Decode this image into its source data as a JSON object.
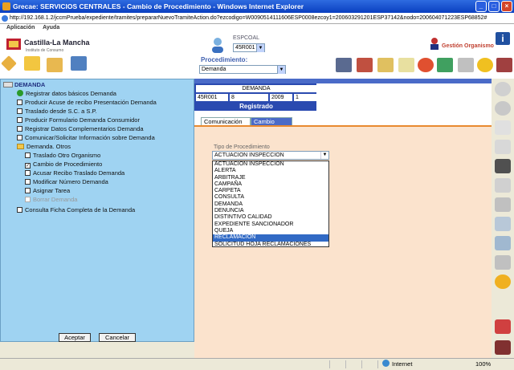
{
  "window": {
    "title": "Grecae: SERVICIOS CENTRALES - Cambio de Procedimiento - Windows Internet Explorer"
  },
  "address": {
    "url": "http://192.168.1.2/jccmPrueba/expediente/tramites/prepararNuevoTramiteAction.do?ezcodigo=W0090514111606ESP0008ezcoy1=200603291201ESP37142&nodo=200604071223ESP68852#"
  },
  "menubar": {
    "items": [
      "Aplicación",
      "Ayuda"
    ]
  },
  "header": {
    "logo_title": "Castilla-La Mancha",
    "logo_subtitle": "Instituto de Consumo",
    "user_label": "ESPCOAL",
    "user_select": "45R001",
    "gestion_label": "Gestión Organismo",
    "info_label": "i",
    "procedimiento_label": "Procedimiento:",
    "procedimiento_select": "Demanda"
  },
  "tree": {
    "root": "DEMANDA",
    "items": [
      {
        "label": "Registrar datos básicos Demanda"
      },
      {
        "label": "Producir Acuse de recibo Presentación Demanda"
      },
      {
        "label": "Traslado desde S.C. a S.P."
      },
      {
        "label": "Producir Formulario Demanda Consumidor"
      },
      {
        "label": "Registrar Datos Complementarios Demanda"
      },
      {
        "label": "Comunicar/Solicitar Información sobre Demanda"
      }
    ],
    "group": "Demanda. Otros",
    "sub_items": [
      {
        "label": "Traslado Otro Organismo"
      },
      {
        "label": "Cambio de Procedimiento",
        "check": "✓"
      },
      {
        "label": "Acusar Recibo Traslado Demanda"
      },
      {
        "label": "Modificar Número Demanda"
      },
      {
        "label": "Asignar Tarea"
      },
      {
        "label": "Borrar Demanda"
      }
    ],
    "last_item": "Consulta Ficha Completa de la Demanda",
    "accept_label": "Aceptar",
    "cancel_label": "Cancelar"
  },
  "demanda_table": {
    "header": "DEMANDA",
    "cells": [
      "45R001",
      "8",
      "2009",
      "1"
    ],
    "status": "Registrado"
  },
  "tabs": [
    {
      "label": "Comunicación"
    },
    {
      "label": "Cambio Proc."
    }
  ],
  "form": {
    "tipo_label": "Tipo de Procedimiento",
    "tipo_value": "ACTUACION INSPECCION",
    "options": [
      "ACTUACION INSPECCION",
      "ALERTA",
      "ARBITRAJE",
      "CAMPAÑA",
      "CARPETA",
      "CONSULTA",
      "DEMANDA",
      "DENUNCIA",
      "DISTINTIVO CALIDAD",
      "EXPEDIENTE SANCIONADOR",
      "QUEJA",
      "RECLAMACION",
      "SOLICITUD HOJA RECLAMACIONES"
    ],
    "highlighted_option": "RECLAMACION"
  },
  "status": {
    "zone": "Internet",
    "zoom": "100%"
  }
}
